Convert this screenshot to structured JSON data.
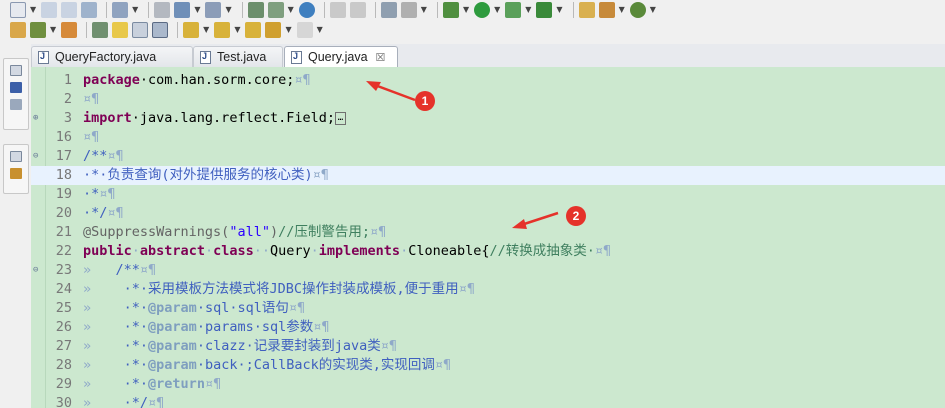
{
  "tabs": [
    {
      "label": "QueryFactory.java",
      "active": false
    },
    {
      "label": "Test.java",
      "active": false
    },
    {
      "label": "Query.java",
      "active": true,
      "close": "☒"
    }
  ],
  "toolbar": {
    "row1": [
      "new-icon",
      "save-icon",
      "save-all-icon",
      "print-icon",
      "build-icon",
      "debug-icon",
      "run-icon",
      "external-tools-icon",
      "open-type-icon",
      "globe-icon",
      "back-icon",
      "search-icon",
      "coverage-icon",
      "bug-icon",
      "play-icon",
      "profile-icon",
      "run-last-icon",
      "new-package-icon",
      "open-folder-icon",
      "settings-icon"
    ],
    "row2": [
      "open-icon",
      "pencil-icon",
      "folder-icon",
      "spell-icon",
      "highlighter-icon",
      "format-icon",
      "show-whitespace-icon",
      "down-icon",
      "up-icon",
      "prev-edit-icon",
      "back-arrow-icon",
      "forward-arrow-icon"
    ]
  },
  "editor": {
    "lines": [
      {
        "num": "1",
        "fold": "",
        "html_key": 0
      },
      {
        "num": "2"
      },
      {
        "num": "3"
      },
      {
        "num": "16"
      },
      {
        "num": "17"
      },
      {
        "num": "18"
      },
      {
        "num": "19"
      },
      {
        "num": "20"
      },
      {
        "num": "21"
      },
      {
        "num": "22"
      },
      {
        "num": "23"
      },
      {
        "num": "24"
      },
      {
        "num": "25"
      },
      {
        "num": "26"
      },
      {
        "num": "27"
      },
      {
        "num": "28"
      },
      {
        "num": "29"
      },
      {
        "num": "30"
      }
    ],
    "code": {
      "l1_kw": "package",
      "l1_rest": "·com.han.sorm.core;",
      "eol": "¤¶",
      "l3_kw": "import",
      "l3_rest": "·java.lang.reflect.Field;",
      "l17": "/**",
      "l18": "·*·负责查询(对外提供服务的核心类)",
      "l19": "·*",
      "l20": "·*/",
      "l21_ann": "@SuppressWarnings(",
      "l21_str": "\"all\"",
      "l21_close": ")",
      "l21_cm": "//压制警告用;",
      "l22_kw1": "public",
      "l22_kw2": "abstract",
      "l22_kw3": "class",
      "l22_name": "Query",
      "l22_kw4": "implements",
      "l22_iface": "Cloneable{",
      "l22_cm": "//转换成抽象类·",
      "tab": "»",
      "l23": "/**",
      "l24": "·*·采用模板方法模式将JDBC操作封装成模板,便于重用",
      "l25_tag": "@param",
      "l25_rest": "·sql·sql语句",
      "l26_tag": "@param",
      "l26_rest": "·params·sql参数",
      "l27_tag": "@param",
      "l27_rest": "·clazz·记录要封装到java类",
      "l28_tag": "@param",
      "l28_rest": "·back·;CallBack的实现类,实现回调",
      "l29_tag": "@return",
      "l30": "·*/"
    }
  },
  "annotations": [
    {
      "label": "1"
    },
    {
      "label": "2"
    }
  ],
  "colors": {
    "editor_bg": "#cce8cf",
    "current_line": "#e8f2fe",
    "keyword": "#7f0055",
    "string": "#2a00ff",
    "comment": "#3f7f5f",
    "javadoc": "#3f5fbf",
    "annotation_red": "#e5322a"
  }
}
